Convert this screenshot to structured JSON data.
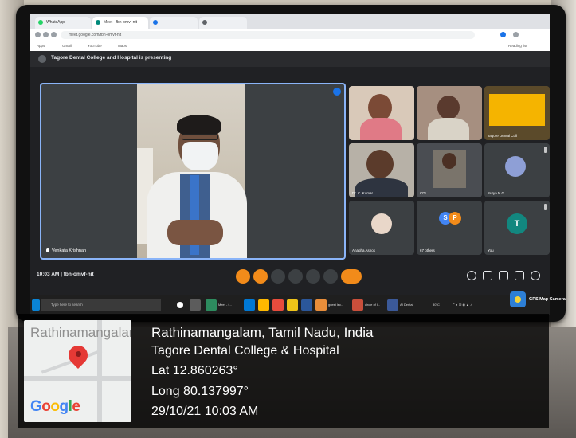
{
  "browser": {
    "tabs": [
      "WhatsApp",
      "Meet - fbn-omvf-nit",
      "",
      ""
    ],
    "address": "meet.google.com/fbn-omvf-nit",
    "bookmarks": [
      "Apps",
      "Gmail",
      "YouTube",
      "Maps",
      "Reading list"
    ]
  },
  "meet": {
    "presenting_banner": "Tagore Dental College and Hospital is presenting",
    "main_speaker": "Venkata Krishnan",
    "meeting_time": "10:03 AM",
    "meeting_code": "fbn-omvf-nit",
    "participants": [
      {
        "name": ""
      },
      {
        "name": ""
      },
      {
        "name": "Tagore Dental Coll"
      },
      {
        "name": "Dr. C. Kumar"
      },
      {
        "name": "CDL"
      },
      {
        "name": "Surya N G"
      },
      {
        "name": "Anagha Ashok"
      },
      {
        "name": "67 others",
        "initials": [
          "S",
          "P"
        ]
      },
      {
        "name": "You",
        "initial": "T"
      }
    ]
  },
  "taskbar": {
    "search_placeholder": "Type here to search",
    "apps": [
      "Meet - f...",
      "guest lec...",
      "circle of I...",
      "AI Dental"
    ],
    "weather": "30°C",
    "gps_app": "GPS Map Camera"
  },
  "stamp": {
    "map_town": "Rathinamangalam",
    "map_brand": "Google",
    "location": "Rathinamangalam, Tamil Nadu, India",
    "place": "Tagore Dental College & Hospital",
    "lat": "Lat 12.860263°",
    "long": "Long 80.137997°",
    "datetime": "29/10/21 10:03 AM"
  },
  "colors": {
    "accent_blue": "#8ab4f8",
    "hangup_red": "#ea4335",
    "reaction_orange": "#f28b1a",
    "avatar_teal": "#12877f"
  }
}
